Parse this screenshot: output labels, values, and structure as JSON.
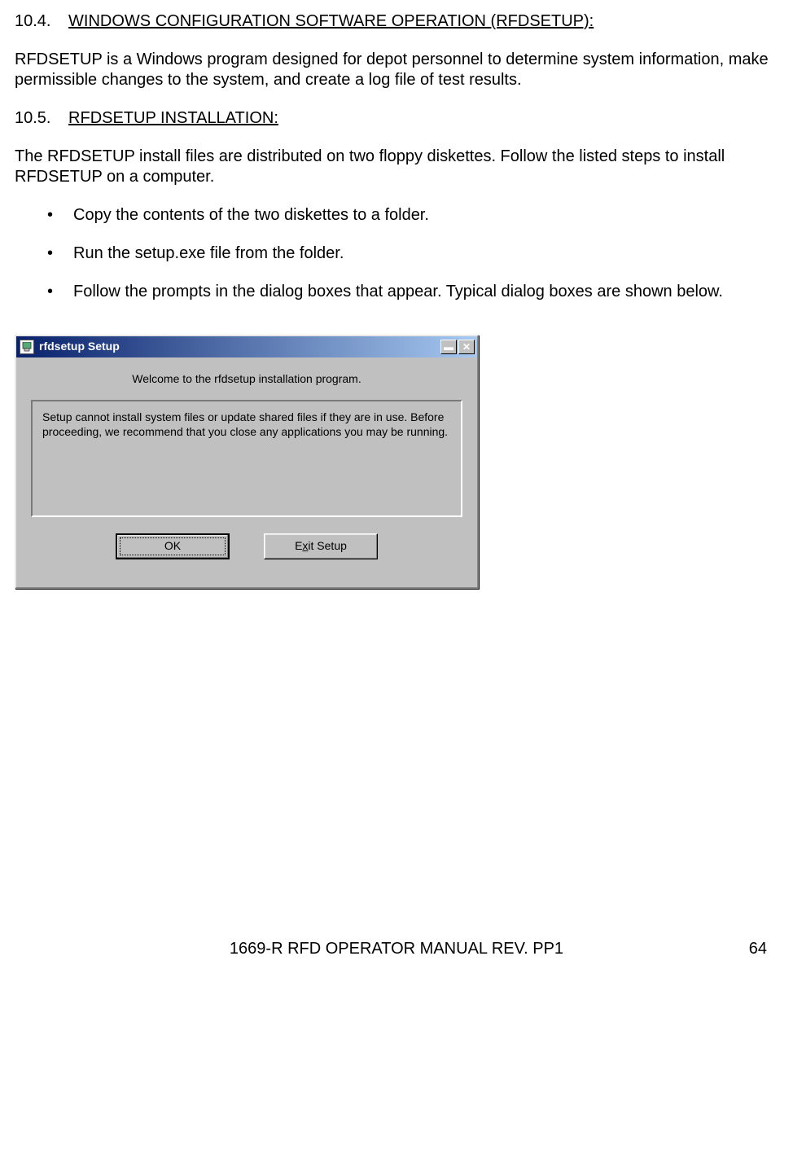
{
  "sections": {
    "s1": {
      "num": "10.4.",
      "title": "WINDOWS CONFIGURATION SOFTWARE OPERATION (RFDSETUP):"
    },
    "s2": {
      "num": "10.5.",
      "title": "RFDSETUP INSTALLATION:"
    }
  },
  "paragraphs": {
    "p1": "RFDSETUP is a Windows program designed for depot personnel to determine system information, make permissible changes to the system, and create a log file of test results.",
    "p2": "The RFDSETUP install files are distributed on two floppy diskettes.  Follow the listed steps to install RFDSETUP on a computer."
  },
  "bullets": [
    "Copy the contents of the two diskettes to a folder.",
    "Run the setup.exe file from the folder.",
    "Follow the prompts in the dialog boxes that appear.  Typical dialog boxes are shown below."
  ],
  "dialog": {
    "title": "rfdsetup Setup",
    "welcome": "Welcome to the rfdsetup installation program.",
    "panel_text": "Setup cannot install system files or update shared files if they are in use. Before proceeding, we recommend that you close any applications you may be running.",
    "ok_label": "OK",
    "exit_prefix": "E",
    "exit_key": "x",
    "exit_suffix": "it Setup",
    "minimize_glyph": "▬",
    "close_glyph": "✕"
  },
  "footer": {
    "text": "1669-R RFD OPERATOR MANUAL REV. PP1",
    "page": "64"
  }
}
